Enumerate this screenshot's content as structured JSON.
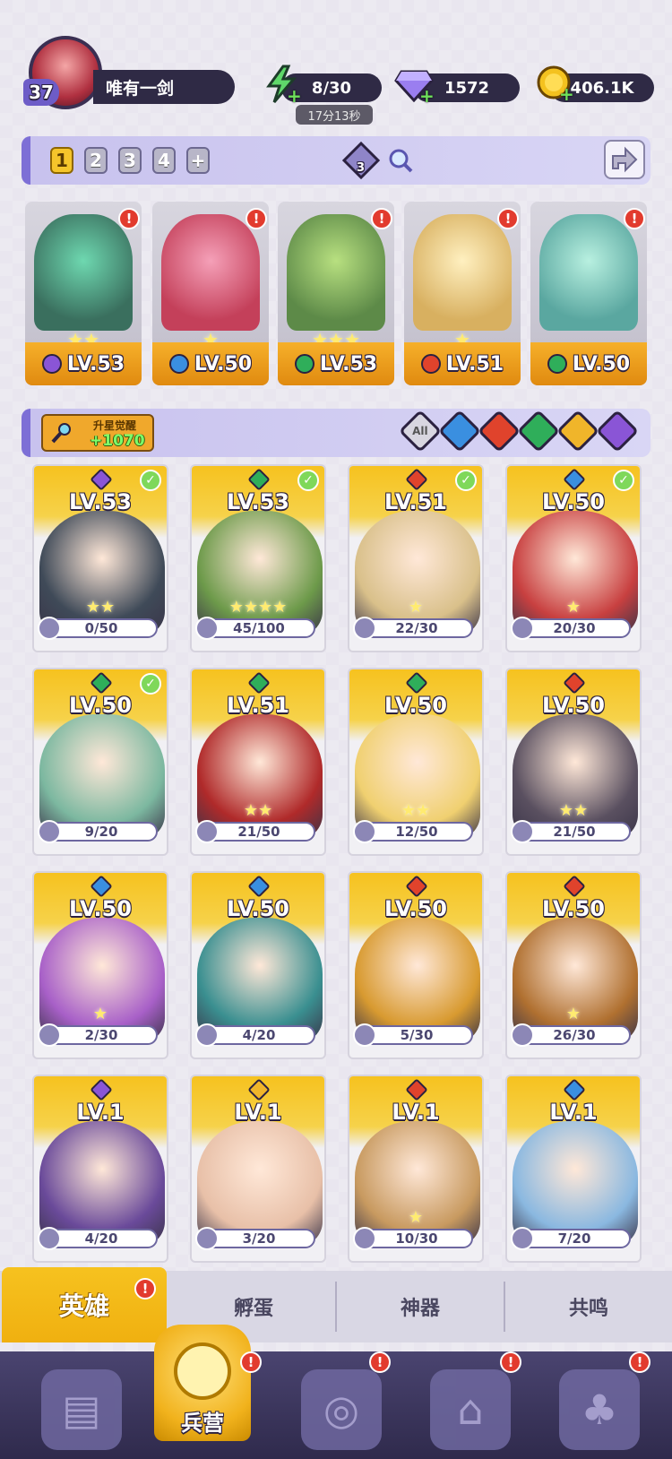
{
  "player": {
    "level": "37",
    "name": "唯有一剑"
  },
  "resources": {
    "energy": {
      "icon": "lightning-icon",
      "value": "8/30",
      "timer": "17分13秒"
    },
    "gems": {
      "icon": "gem-icon",
      "value": "1572"
    },
    "gold": {
      "icon": "coin-icon",
      "value": "406.1K"
    }
  },
  "team": {
    "tabs": [
      "1",
      "2",
      "3",
      "4",
      "+"
    ],
    "active": "1",
    "element_count": "3"
  },
  "lineup": [
    {
      "level": "LV.53",
      "element": "dark",
      "stars": "★★",
      "art": "#3a6f5e"
    },
    {
      "level": "LV.50",
      "element": "water",
      "stars": "★",
      "art": "#c4405a"
    },
    {
      "level": "LV.53",
      "element": "wind",
      "stars": "★★★",
      "art": "#5d8a48"
    },
    {
      "level": "LV.51",
      "element": "fire",
      "stars": "★",
      "art": "#d8b060"
    },
    {
      "level": "LV.50",
      "element": "wind",
      "stars": "",
      "art": "#5aa7a0"
    }
  ],
  "awaken": {
    "label": "升星觉醒",
    "value": "+1070"
  },
  "filters": {
    "all_label": "All"
  },
  "elements": {
    "dark": "#8a55d6",
    "water": "#3a8fe0",
    "fire": "#e0432c",
    "wind": "#2fae5a",
    "light": "#f0b52a"
  },
  "heroes": [
    {
      "level": "LV.53",
      "element": "dark",
      "checked": true,
      "frags": "0/50",
      "stars": "★★",
      "art": "#3f4a58"
    },
    {
      "level": "LV.53",
      "element": "wind",
      "checked": true,
      "frags": "45/100",
      "stars": "★★★★",
      "art": "#6d9a4a"
    },
    {
      "level": "LV.51",
      "element": "fire",
      "checked": true,
      "frags": "22/30",
      "stars": "★",
      "art": "#d9c08a"
    },
    {
      "level": "LV.50",
      "element": "water",
      "checked": true,
      "frags": "20/30",
      "stars": "★",
      "art": "#c84040"
    },
    {
      "level": "LV.50",
      "element": "wind",
      "checked": true,
      "frags": "9/20",
      "stars": "",
      "art": "#7cb8a0"
    },
    {
      "level": "LV.51",
      "element": "wind",
      "checked": false,
      "frags": "21/50",
      "stars": "★★",
      "art": "#b02a2a"
    },
    {
      "level": "LV.50",
      "element": "wind",
      "checked": false,
      "frags": "12/50",
      "stars": "★★",
      "art": "#f0d070"
    },
    {
      "level": "LV.50",
      "element": "fire",
      "checked": false,
      "frags": "21/50",
      "stars": "★★",
      "art": "#5a5060"
    },
    {
      "level": "LV.50",
      "element": "water",
      "checked": false,
      "frags": "2/30",
      "stars": "★",
      "art": "#a860c8"
    },
    {
      "level": "LV.50",
      "element": "water",
      "checked": false,
      "frags": "4/20",
      "stars": "",
      "art": "#3a8f90"
    },
    {
      "level": "LV.50",
      "element": "fire",
      "checked": false,
      "frags": "5/30",
      "stars": "",
      "art": "#d89a30"
    },
    {
      "level": "LV.50",
      "element": "fire",
      "checked": false,
      "frags": "26/30",
      "stars": "★",
      "art": "#b07030"
    },
    {
      "level": "LV.1",
      "element": "dark",
      "checked": false,
      "frags": "4/20",
      "stars": "",
      "art": "#6a4a9a"
    },
    {
      "level": "LV.1",
      "element": "light",
      "checked": false,
      "frags": "3/20",
      "stars": "",
      "art": "#e8c0a8"
    },
    {
      "level": "LV.1",
      "element": "fire",
      "checked": false,
      "frags": "10/30",
      "stars": "★",
      "art": "#c89a60"
    },
    {
      "level": "LV.1",
      "element": "water",
      "checked": false,
      "frags": "7/20",
      "stars": "",
      "art": "#8ab8e0"
    }
  ],
  "sub_tabs": [
    "英雄",
    "孵蛋",
    "神器",
    "共鸣"
  ],
  "nav": {
    "active_label": "兵营"
  }
}
